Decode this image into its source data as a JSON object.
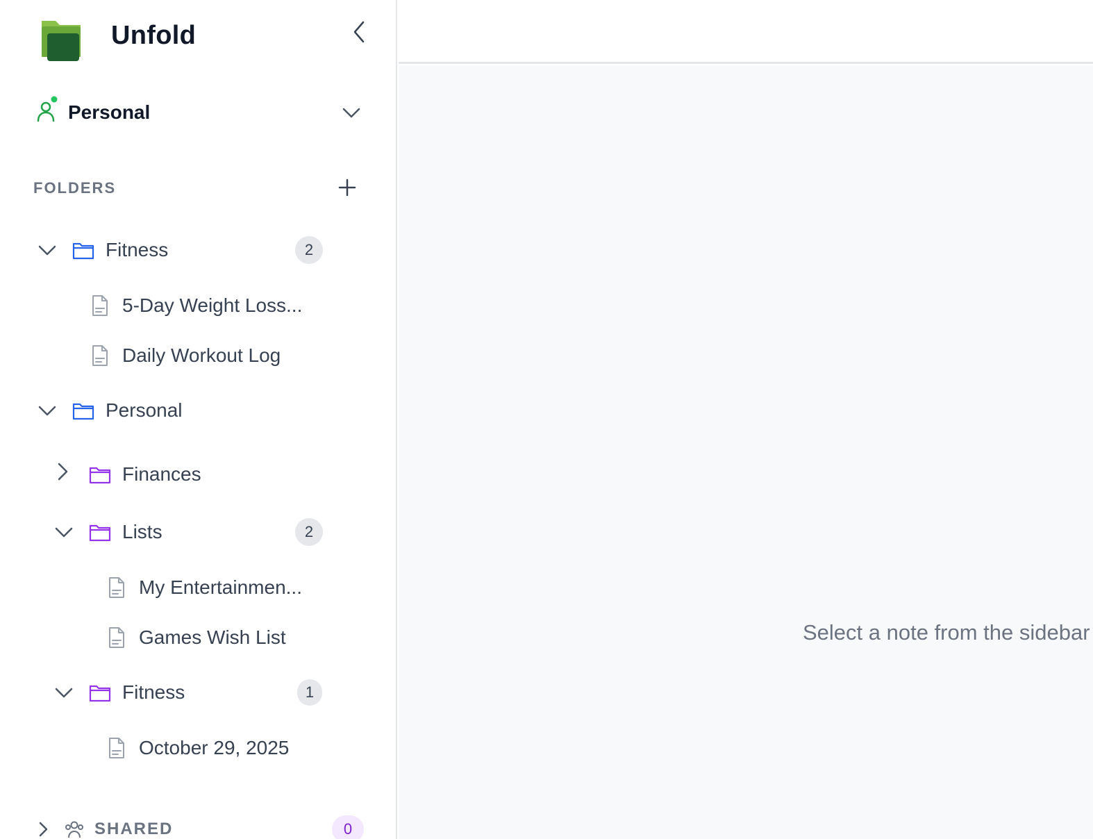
{
  "app": {
    "title": "Unfold"
  },
  "sidebar": {
    "workspace": {
      "label": "Personal"
    },
    "folders_header": "FOLDERS",
    "tree": {
      "fitness": {
        "label": "Fitness",
        "count": "2"
      },
      "note_weight_loss": {
        "label": "5-Day Weight Loss..."
      },
      "note_workout_log": {
        "label": "Daily Workout Log"
      },
      "personal": {
        "label": "Personal"
      },
      "finances": {
        "label": "Finances"
      },
      "lists": {
        "label": "Lists",
        "count": "2"
      },
      "note_entertainment": {
        "label": "My Entertainmen..."
      },
      "note_games": {
        "label": "Games Wish List"
      },
      "personal_fitness": {
        "label": "Fitness",
        "count": "1"
      },
      "note_october": {
        "label": "October 29, 2025"
      }
    },
    "shared": {
      "label": "SHARED",
      "count": "0"
    }
  },
  "main": {
    "empty_message": "Select a note from the sidebar"
  },
  "colors": {
    "top_folder": "#2563eb",
    "sub_folder": "#9333ea",
    "workspace_icon": "#22a34a",
    "badge_bg": "#e5e7eb",
    "shared_badge_bg": "#f3e8ff"
  }
}
